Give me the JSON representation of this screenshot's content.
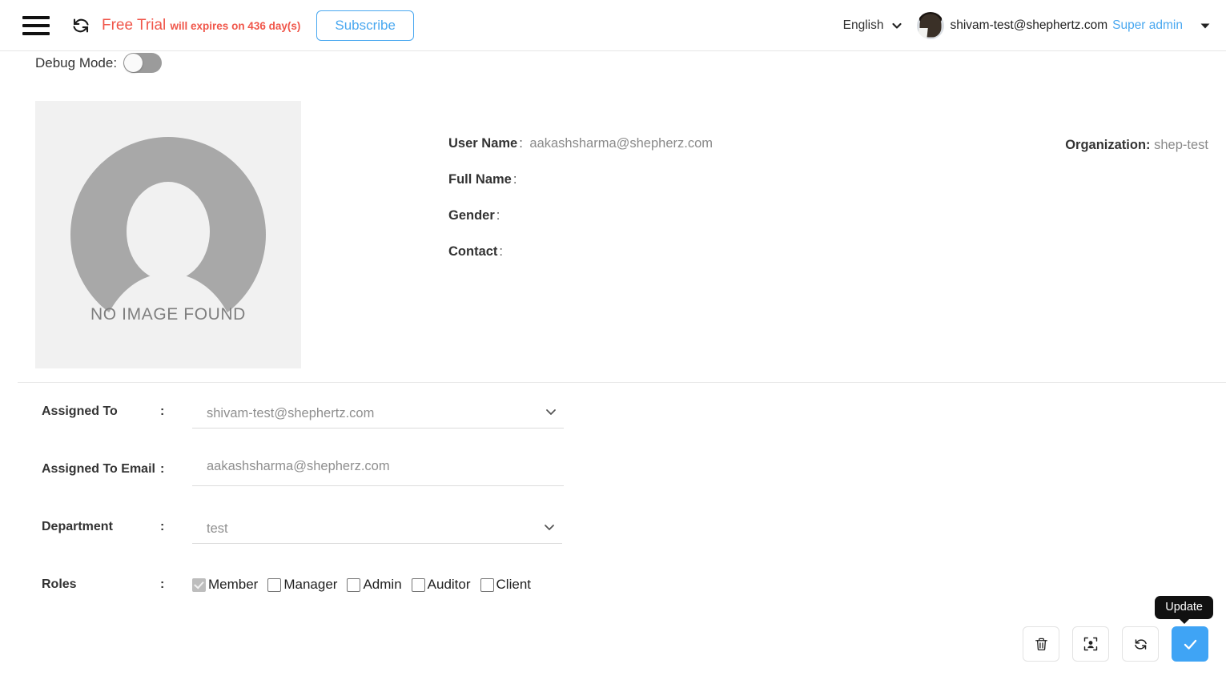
{
  "topbar": {
    "menu_icon": "hamburger-icon",
    "trial_icon": "refresh-icon",
    "trial_title": "Free Trial",
    "trial_subtext": "will expires on 436 day(s)",
    "subscribe_label": "Subscribe",
    "language": "English",
    "language_caret_icon": "chevron-down-icon",
    "user_email": "shivam-test@shephertz.com",
    "user_role": "Super admin",
    "avatar_icon": "user-avatar",
    "menu_caret_icon": "chevron-down-icon",
    "trial_color": "#f0564a",
    "accent_color": "#4aa8f0"
  },
  "debug": {
    "label": "Debug Mode:",
    "enabled": false
  },
  "profile": {
    "photo_placeholder_text": "NO IMAGE FOUND",
    "fields": [
      {
        "label": "User Name",
        "colon": ":",
        "value": "aakashsharma@shepherz.com"
      },
      {
        "label": "Full Name",
        "colon": ":",
        "value": ""
      },
      {
        "label": "Gender",
        "colon": ":",
        "value": ""
      },
      {
        "label": "Contact",
        "colon": ":",
        "value": ""
      }
    ],
    "organization_label": "Organization",
    "organization_colon": ":",
    "organization_value": "shep-test"
  },
  "form": {
    "assigned_to": {
      "label": "Assigned To",
      "colon": ":",
      "value": "shivam-test@shephertz.com",
      "caret_icon": "chevron-down-icon"
    },
    "assigned_to_email": {
      "label": "Assigned To Email",
      "colon": ":",
      "value": "aakashsharma@shepherz.com",
      "placeholder": "Assigned To Email"
    },
    "department": {
      "label": "Department",
      "colon": ":",
      "value": "test",
      "caret_icon": "chevron-down-icon"
    },
    "roles": {
      "label": "Roles",
      "colon": ":",
      "items": [
        {
          "label": "Member",
          "checked": true,
          "disabled": true
        },
        {
          "label": "Manager",
          "checked": false,
          "disabled": false
        },
        {
          "label": "Admin",
          "checked": false,
          "disabled": false
        },
        {
          "label": "Auditor",
          "checked": false,
          "disabled": false
        },
        {
          "label": "Client",
          "checked": false,
          "disabled": false
        }
      ]
    }
  },
  "actions": {
    "delete_icon": "trash-icon",
    "assign_user_icon": "user-focus-icon",
    "reset_icon": "refresh-icon",
    "update_icon": "check-icon",
    "update_tooltip": "Update",
    "update_color": "#3fa4f5"
  }
}
